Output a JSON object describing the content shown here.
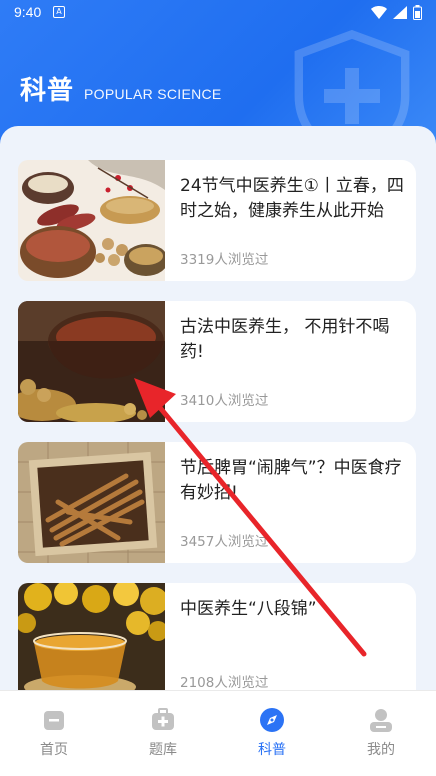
{
  "status": {
    "time": "9:40",
    "badge": "A"
  },
  "header": {
    "title": "科普",
    "subtitle": "POPULAR SCIENCE"
  },
  "articles": [
    {
      "title": "24节气中医养生①丨立春，四时之始，健康养生从此开始",
      "views": "3319人浏览过"
    },
    {
      "title": "古法中医养生， 不用针不喝药!",
      "views": "3410人浏览过"
    },
    {
      "title": "节后脾胃“闹脾气”？中医食疗有妙招!",
      "views": "3457人浏览过"
    },
    {
      "title": "中医养生“八段锦”",
      "views": "2108人浏览过"
    }
  ],
  "tabs": [
    {
      "label": "首页",
      "icon": "home-icon"
    },
    {
      "label": "题库",
      "icon": "medkit-icon"
    },
    {
      "label": "科普",
      "icon": "compass-icon"
    },
    {
      "label": "我的",
      "icon": "user-icon"
    }
  ],
  "colors": {
    "accent": "#2b73f5",
    "arrow": "#e8252a"
  }
}
